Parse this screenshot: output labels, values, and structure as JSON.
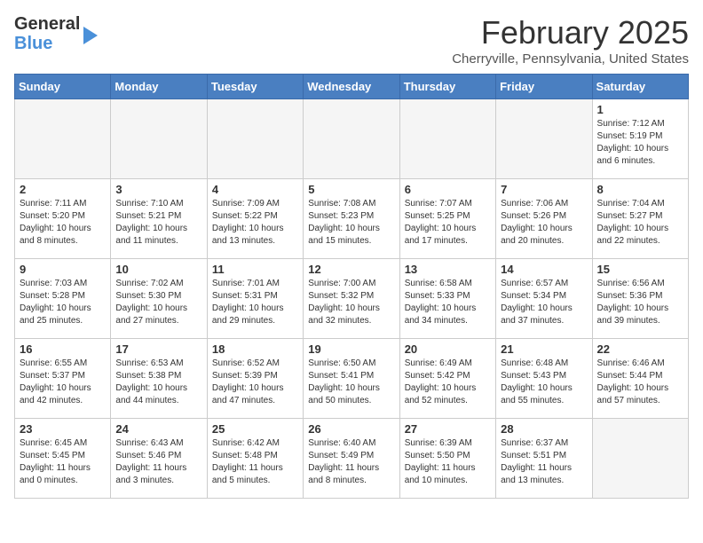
{
  "header": {
    "logo_line1": "General",
    "logo_line2": "Blue",
    "month_title": "February 2025",
    "subtitle": "Cherryville, Pennsylvania, United States"
  },
  "days_of_week": [
    "Sunday",
    "Monday",
    "Tuesday",
    "Wednesday",
    "Thursday",
    "Friday",
    "Saturday"
  ],
  "weeks": [
    [
      {
        "day": "",
        "info": ""
      },
      {
        "day": "",
        "info": ""
      },
      {
        "day": "",
        "info": ""
      },
      {
        "day": "",
        "info": ""
      },
      {
        "day": "",
        "info": ""
      },
      {
        "day": "",
        "info": ""
      },
      {
        "day": "1",
        "info": "Sunrise: 7:12 AM\nSunset: 5:19 PM\nDaylight: 10 hours\nand 6 minutes."
      }
    ],
    [
      {
        "day": "2",
        "info": "Sunrise: 7:11 AM\nSunset: 5:20 PM\nDaylight: 10 hours\nand 8 minutes."
      },
      {
        "day": "3",
        "info": "Sunrise: 7:10 AM\nSunset: 5:21 PM\nDaylight: 10 hours\nand 11 minutes."
      },
      {
        "day": "4",
        "info": "Sunrise: 7:09 AM\nSunset: 5:22 PM\nDaylight: 10 hours\nand 13 minutes."
      },
      {
        "day": "5",
        "info": "Sunrise: 7:08 AM\nSunset: 5:23 PM\nDaylight: 10 hours\nand 15 minutes."
      },
      {
        "day": "6",
        "info": "Sunrise: 7:07 AM\nSunset: 5:25 PM\nDaylight: 10 hours\nand 17 minutes."
      },
      {
        "day": "7",
        "info": "Sunrise: 7:06 AM\nSunset: 5:26 PM\nDaylight: 10 hours\nand 20 minutes."
      },
      {
        "day": "8",
        "info": "Sunrise: 7:04 AM\nSunset: 5:27 PM\nDaylight: 10 hours\nand 22 minutes."
      }
    ],
    [
      {
        "day": "9",
        "info": "Sunrise: 7:03 AM\nSunset: 5:28 PM\nDaylight: 10 hours\nand 25 minutes."
      },
      {
        "day": "10",
        "info": "Sunrise: 7:02 AM\nSunset: 5:30 PM\nDaylight: 10 hours\nand 27 minutes."
      },
      {
        "day": "11",
        "info": "Sunrise: 7:01 AM\nSunset: 5:31 PM\nDaylight: 10 hours\nand 29 minutes."
      },
      {
        "day": "12",
        "info": "Sunrise: 7:00 AM\nSunset: 5:32 PM\nDaylight: 10 hours\nand 32 minutes."
      },
      {
        "day": "13",
        "info": "Sunrise: 6:58 AM\nSunset: 5:33 PM\nDaylight: 10 hours\nand 34 minutes."
      },
      {
        "day": "14",
        "info": "Sunrise: 6:57 AM\nSunset: 5:34 PM\nDaylight: 10 hours\nand 37 minutes."
      },
      {
        "day": "15",
        "info": "Sunrise: 6:56 AM\nSunset: 5:36 PM\nDaylight: 10 hours\nand 39 minutes."
      }
    ],
    [
      {
        "day": "16",
        "info": "Sunrise: 6:55 AM\nSunset: 5:37 PM\nDaylight: 10 hours\nand 42 minutes."
      },
      {
        "day": "17",
        "info": "Sunrise: 6:53 AM\nSunset: 5:38 PM\nDaylight: 10 hours\nand 44 minutes."
      },
      {
        "day": "18",
        "info": "Sunrise: 6:52 AM\nSunset: 5:39 PM\nDaylight: 10 hours\nand 47 minutes."
      },
      {
        "day": "19",
        "info": "Sunrise: 6:50 AM\nSunset: 5:41 PM\nDaylight: 10 hours\nand 50 minutes."
      },
      {
        "day": "20",
        "info": "Sunrise: 6:49 AM\nSunset: 5:42 PM\nDaylight: 10 hours\nand 52 minutes."
      },
      {
        "day": "21",
        "info": "Sunrise: 6:48 AM\nSunset: 5:43 PM\nDaylight: 10 hours\nand 55 minutes."
      },
      {
        "day": "22",
        "info": "Sunrise: 6:46 AM\nSunset: 5:44 PM\nDaylight: 10 hours\nand 57 minutes."
      }
    ],
    [
      {
        "day": "23",
        "info": "Sunrise: 6:45 AM\nSunset: 5:45 PM\nDaylight: 11 hours\nand 0 minutes."
      },
      {
        "day": "24",
        "info": "Sunrise: 6:43 AM\nSunset: 5:46 PM\nDaylight: 11 hours\nand 3 minutes."
      },
      {
        "day": "25",
        "info": "Sunrise: 6:42 AM\nSunset: 5:48 PM\nDaylight: 11 hours\nand 5 minutes."
      },
      {
        "day": "26",
        "info": "Sunrise: 6:40 AM\nSunset: 5:49 PM\nDaylight: 11 hours\nand 8 minutes."
      },
      {
        "day": "27",
        "info": "Sunrise: 6:39 AM\nSunset: 5:50 PM\nDaylight: 11 hours\nand 10 minutes."
      },
      {
        "day": "28",
        "info": "Sunrise: 6:37 AM\nSunset: 5:51 PM\nDaylight: 11 hours\nand 13 minutes."
      },
      {
        "day": "",
        "info": ""
      }
    ]
  ]
}
